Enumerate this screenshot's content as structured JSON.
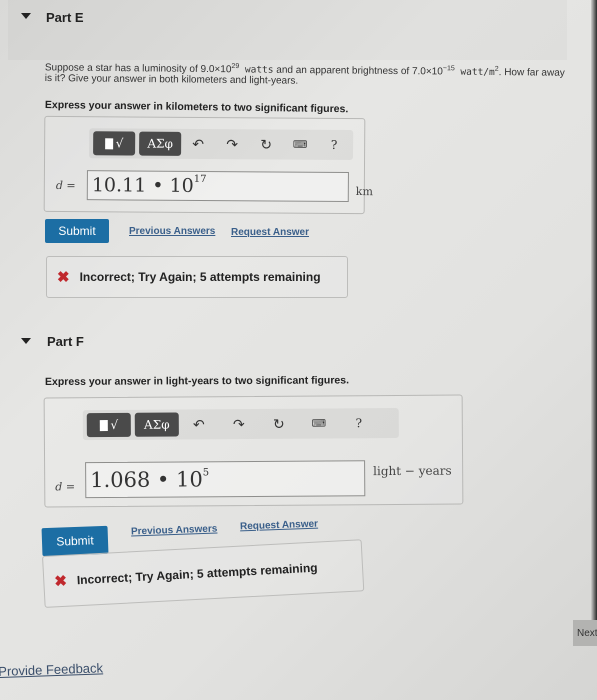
{
  "partE": {
    "title": "Part E",
    "prompt_prefix": "Suppose a star has a luminosity of ",
    "luminosity_mantissa": "9.0×10",
    "luminosity_exp": "29",
    "luminosity_unit": " watts",
    "prompt_mid": " and an apparent brightness of ",
    "brightness_mantissa": "7.0×10",
    "brightness_exp": "−15",
    "brightness_unit": " watt/m",
    "brightness_unit_exp": "2",
    "prompt_suffix": ". How far away is it? Give your answer in both kilometers and light-years.",
    "instruction": "Express your answer in kilometers to two significant figures.",
    "variable": "d",
    "equals": "=",
    "answer_mantissa": "10.11 • 10",
    "answer_exp": "17",
    "unit": "km",
    "submit_label": "Submit",
    "previous_answers_label": "Previous Answers",
    "request_answer_label": "Request Answer",
    "feedback": "Incorrect; Try Again; 5 attempts remaining"
  },
  "partF": {
    "title": "Part F",
    "instruction": "Express your answer in light-years to two significant figures.",
    "variable": "d",
    "equals": "=",
    "answer_mantissa": "1.068 • 10",
    "answer_exp": "5",
    "unit": "light − years",
    "submit_label": "Submit",
    "previous_answers_label": "Previous Answers",
    "request_answer_label": "Request Answer",
    "feedback": "Incorrect; Try Again; 5 attempts remaining"
  },
  "toolbar": {
    "templates_icon": "templates-icon",
    "greek_label": "ΑΣφ",
    "undo_glyph": "↶",
    "redo_glyph": "↷",
    "reset_glyph": "↻",
    "keyboard_glyph": "⌨",
    "help_glyph": "?",
    "sqrt_glyph": "√"
  },
  "footer": {
    "next_label": "Next",
    "provide_feedback_label": "Provide Feedback"
  },
  "colors": {
    "submit_bg": "#1c6ea4",
    "error_x": "#c0282d",
    "link": "#3a5f8a"
  }
}
